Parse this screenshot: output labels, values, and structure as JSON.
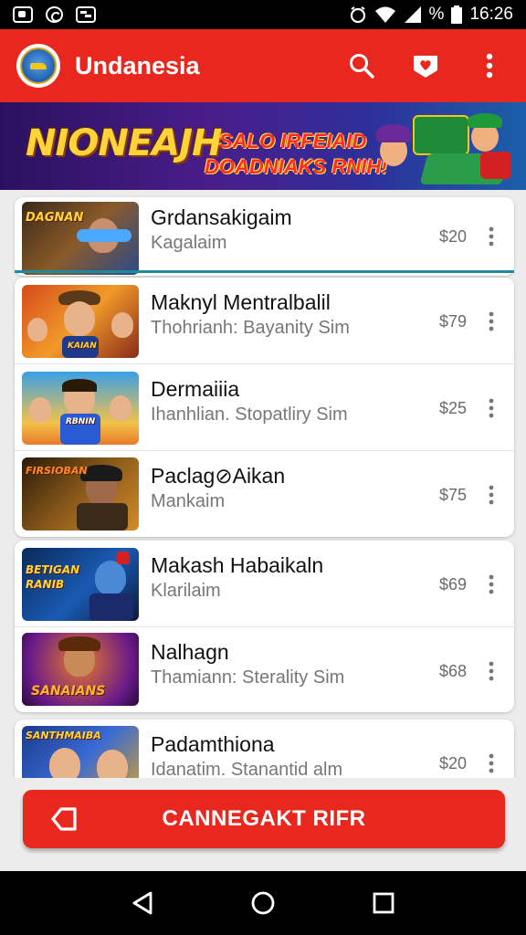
{
  "status_bar": {
    "time": "16:26",
    "battery_text": "%",
    "icons": [
      "gallery-icon",
      "sync-icon",
      "messages-icon",
      "alarm-icon",
      "wifi-icon",
      "signal-icon",
      "battery-icon"
    ]
  },
  "app_bar": {
    "title": "Undanesia",
    "actions": [
      "search-icon",
      "favorites-icon",
      "overflow-menu-icon"
    ],
    "colors": {
      "primary": "#e8281e",
      "on_primary": "#ffffff"
    }
  },
  "banner": {
    "title": "NIONEAJH",
    "subtitle_line1": "SALO IRFEIAID",
    "subtitle_line2": "DOADNIAKS RNIH!"
  },
  "items": [
    {
      "title": "Grdansakigaim",
      "subtitle": "Kagalaim",
      "price": "$20",
      "thumb_label": "DAGNAN"
    },
    {
      "title": "Maknyl Mentralbalil",
      "subtitle": "Thohrianh: Bayanity Sim",
      "price": "$79",
      "thumb_label": "KAIAN"
    },
    {
      "title": "Dermaiiia",
      "subtitle": "Ihanhlian. Stopatliry Sim",
      "price": "$25",
      "thumb_label": "RBNIN"
    },
    {
      "title": "Paclag⊘Aikan",
      "subtitle": "Mankaim",
      "price": "$75",
      "thumb_label": "FIRSIOBAN"
    },
    {
      "title": "Makash Habaikaln",
      "subtitle": "Klarilaim",
      "price": "$69",
      "thumb_label": "BETIGAN RANIB"
    },
    {
      "title": "Nalhagn",
      "subtitle": "Thamiann: Sterality Sim",
      "price": "$68",
      "thumb_label": "SANAIANS"
    },
    {
      "title": "Padamthiona",
      "subtitle": "Idanatim. Stanantid alm",
      "price": "$20",
      "thumb_label": "SANTHMAIBA"
    }
  ],
  "cta": {
    "label": "CANNEGAKT RIFR",
    "icon": "tag-icon"
  },
  "nav_bar": {
    "buttons": [
      "back-icon",
      "home-icon",
      "recents-icon"
    ]
  }
}
